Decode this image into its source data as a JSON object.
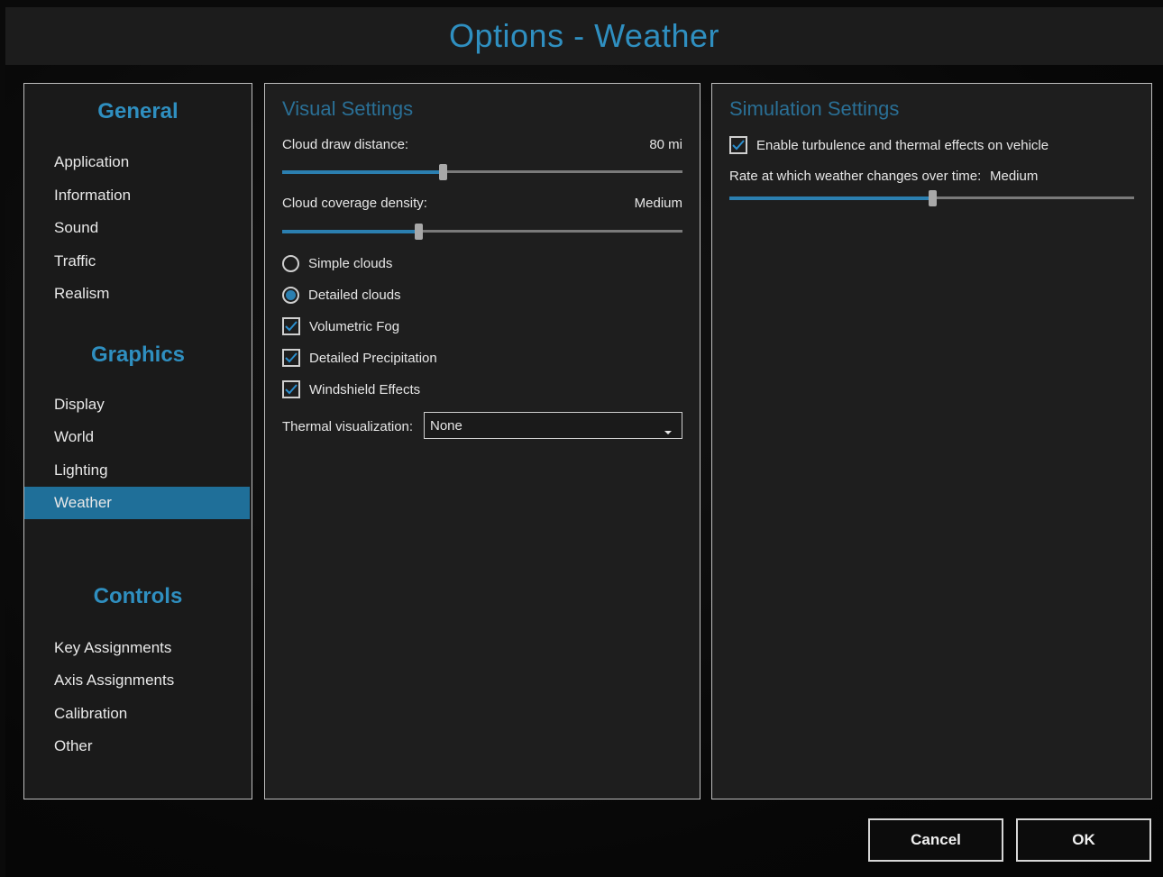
{
  "window": {
    "title": "Options - Weather"
  },
  "nav": {
    "general": {
      "heading": "General",
      "items": [
        "Application",
        "Information",
        "Sound",
        "Traffic",
        "Realism"
      ]
    },
    "graphics": {
      "heading": "Graphics",
      "items": [
        "Display",
        "World",
        "Lighting",
        "Weather"
      ],
      "active": "Weather"
    },
    "controls": {
      "heading": "Controls",
      "items": [
        "Key Assignments",
        "Axis Assignments",
        "Calibration",
        "Other"
      ]
    }
  },
  "visual": {
    "title": "Visual Settings",
    "cloud_draw_distance": {
      "label": "Cloud draw distance:",
      "value": "80 mi",
      "level": 0.4
    },
    "cloud_coverage_density": {
      "label": "Cloud coverage density:",
      "value": "Medium",
      "level": 0.34
    },
    "cloud_mode": {
      "options": [
        "Simple clouds",
        "Detailed clouds"
      ],
      "selected": "Detailed clouds"
    },
    "checkboxes": [
      {
        "label": "Volumetric Fog",
        "checked": true
      },
      {
        "label": "Detailed Precipitation",
        "checked": true
      },
      {
        "label": "Windshield Effects",
        "checked": true
      }
    ],
    "thermal": {
      "label": "Thermal visualization:",
      "value": "None"
    }
  },
  "simulation": {
    "title": "Simulation Settings",
    "turbulence": {
      "label": "Enable turbulence and thermal effects on vehicle",
      "checked": true
    },
    "rate": {
      "label": "Rate at which weather changes over time:",
      "value": "Medium",
      "level": 0.5
    }
  },
  "buttons": {
    "cancel": "Cancel",
    "ok": "OK"
  },
  "colors": {
    "accent": "#2f8fc0",
    "active_bg": "#1f6f99",
    "slider_fill": "#2b7fb0"
  }
}
